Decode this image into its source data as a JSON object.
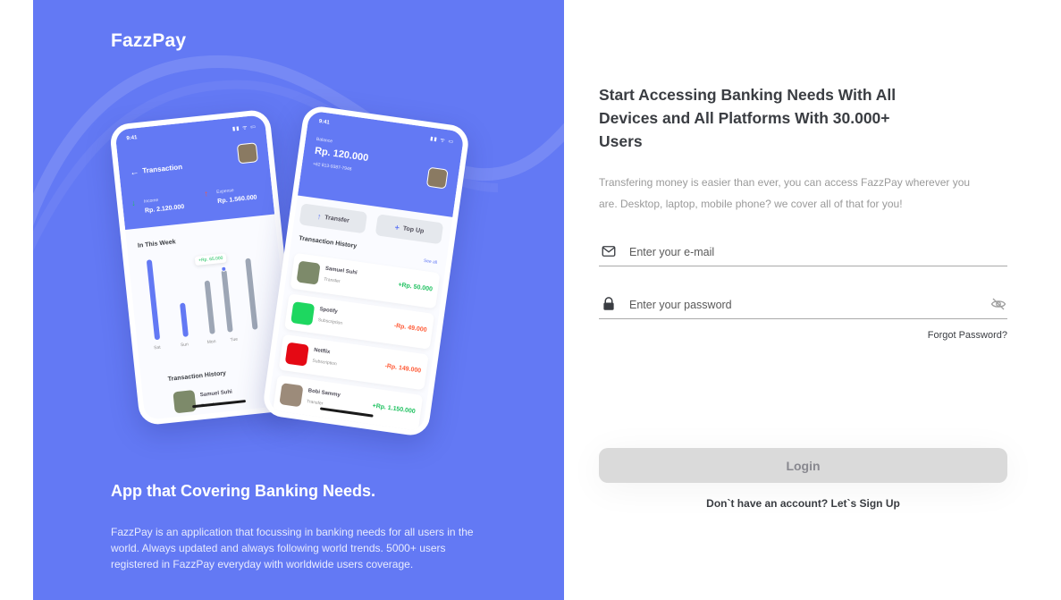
{
  "brand": "FazzPay",
  "left": {
    "title": "App that Covering Banking Needs.",
    "description": "FazzPay is an application that focussing in banking needs for all users in the world. Always updated and always following world trends. 5000+ users registered in FazzPay everyday with worldwide users coverage.",
    "phone_a": {
      "time": "9:41",
      "status_icons": "▮▮ ᯤ ▭",
      "title": "Transaction",
      "income_label": "Income",
      "income_value": "Rp. 2.120.000",
      "expense_label": "Expense",
      "expense_value": "Rp. 1.560.000",
      "week_label": "In This Week",
      "tooltip": "+Rp. 65.000",
      "days": [
        "Sat",
        "Sun",
        "Mon",
        "Tue"
      ],
      "history_label": "Transaction History",
      "history_name": "Samuel Suhi",
      "history_sub": "Transfer"
    },
    "phone_b": {
      "time": "9:41",
      "status_icons": "▮▮ ᯤ ▭",
      "balance_label": "Balance",
      "balance_value": "Rp. 120.000",
      "phone_number": "+62 813-9387-7946",
      "transfer_label": "Transfer",
      "topup_label": "Top Up",
      "history_label": "Transaction History",
      "see_all": "See all",
      "transactions": [
        {
          "name": "Samuel Suhi",
          "type": "Transfer",
          "amount": "+Rp. 50.000",
          "sign": "pos",
          "color": "#7d8a6a"
        },
        {
          "name": "Spotify",
          "type": "Subscription",
          "amount": "-Rp. 49.000",
          "sign": "neg",
          "color": "#1ed760"
        },
        {
          "name": "Netflix",
          "type": "Subscription",
          "amount": "-Rp. 149.000",
          "sign": "neg",
          "color": "#e50914"
        },
        {
          "name": "Bobi Sammy",
          "type": "Transfer",
          "amount": "+Rp. 1.150.000",
          "sign": "pos",
          "color": "#9c8b7a"
        }
      ]
    }
  },
  "right": {
    "title": "Start Accessing Banking Needs With All Devices and All Platforms With 30.000+ Users",
    "description": "Transfering money is easier than ever, you can access FazzPay wherever you are. Desktop, laptop, mobile phone? we cover all of that for you!",
    "email_placeholder": "Enter your e-mail",
    "email_value": "",
    "password_placeholder": "Enter your password",
    "password_value": "",
    "forgot_label": "Forgot Password?",
    "login_label": "Login",
    "signup_text": "Don`t have an account? Let`s Sign Up"
  },
  "colors": {
    "primary": "#6379f4",
    "text_dark": "#3a3d42",
    "text_muted": "#9a9a9a",
    "button_disabled": "#dadada",
    "positive": "#1ec15f",
    "negative": "#ff5b37"
  },
  "icons": {
    "email": "mail-icon",
    "password": "lock-icon",
    "visibility": "eye-off-icon",
    "back": "arrow-left-icon",
    "transfer": "arrow-up-icon",
    "topup": "plus-icon"
  }
}
